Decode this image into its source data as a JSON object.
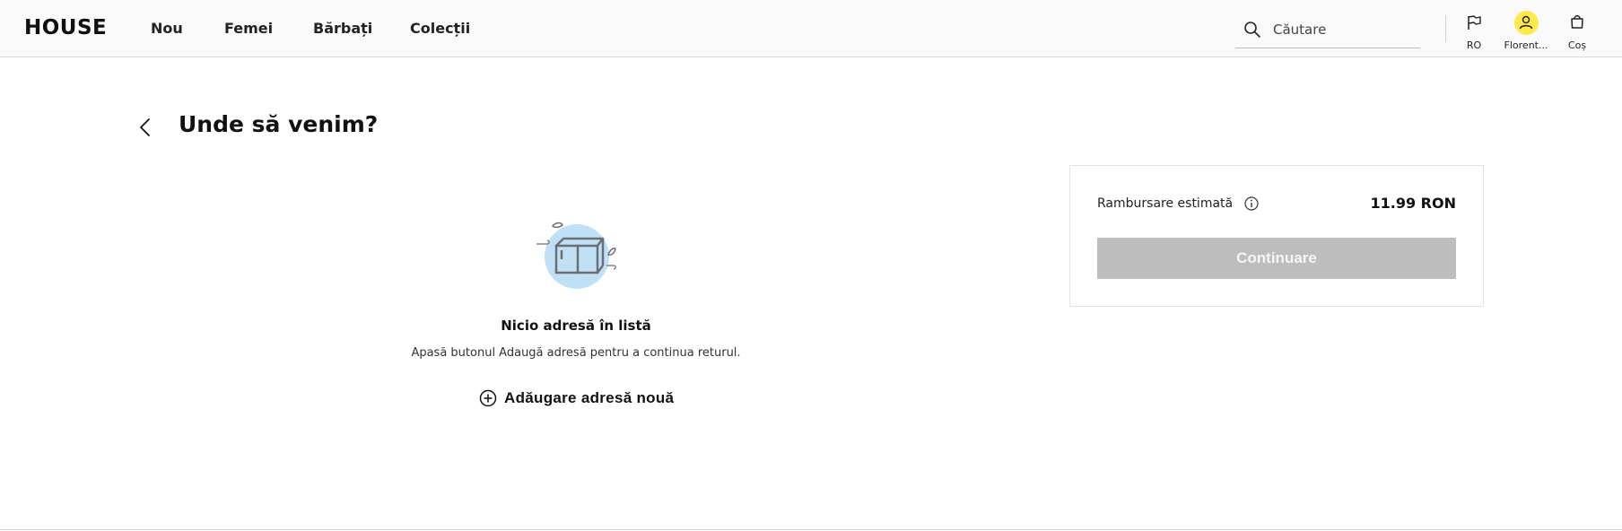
{
  "header": {
    "logo": "HOUSE",
    "nav": [
      {
        "label": "Nou"
      },
      {
        "label": "Femei"
      },
      {
        "label": "Bărbați"
      },
      {
        "label": "Colecții"
      }
    ],
    "search": {
      "placeholder": "Căutare"
    },
    "country": {
      "label": "RO",
      "icon": "flag-icon"
    },
    "account": {
      "label": "Florent...",
      "icon": "user-icon",
      "accent": "#ffe94d"
    },
    "cart": {
      "label": "Coș",
      "icon": "bag-icon"
    }
  },
  "page": {
    "title": "Unde să venim?"
  },
  "empty_state": {
    "illustration": "box-icon",
    "title": "Nicio adresă în listă",
    "description": "Apasă butonul Adaugă adresă pentru a continua returul.",
    "add_button": "Adăugare adresă nouă"
  },
  "summary": {
    "refund_label": "Rambursare estimată",
    "refund_value": "11.99 RON",
    "continue_label": "Continuare",
    "continue_disabled": true,
    "button_color": "#bdbdbd"
  }
}
